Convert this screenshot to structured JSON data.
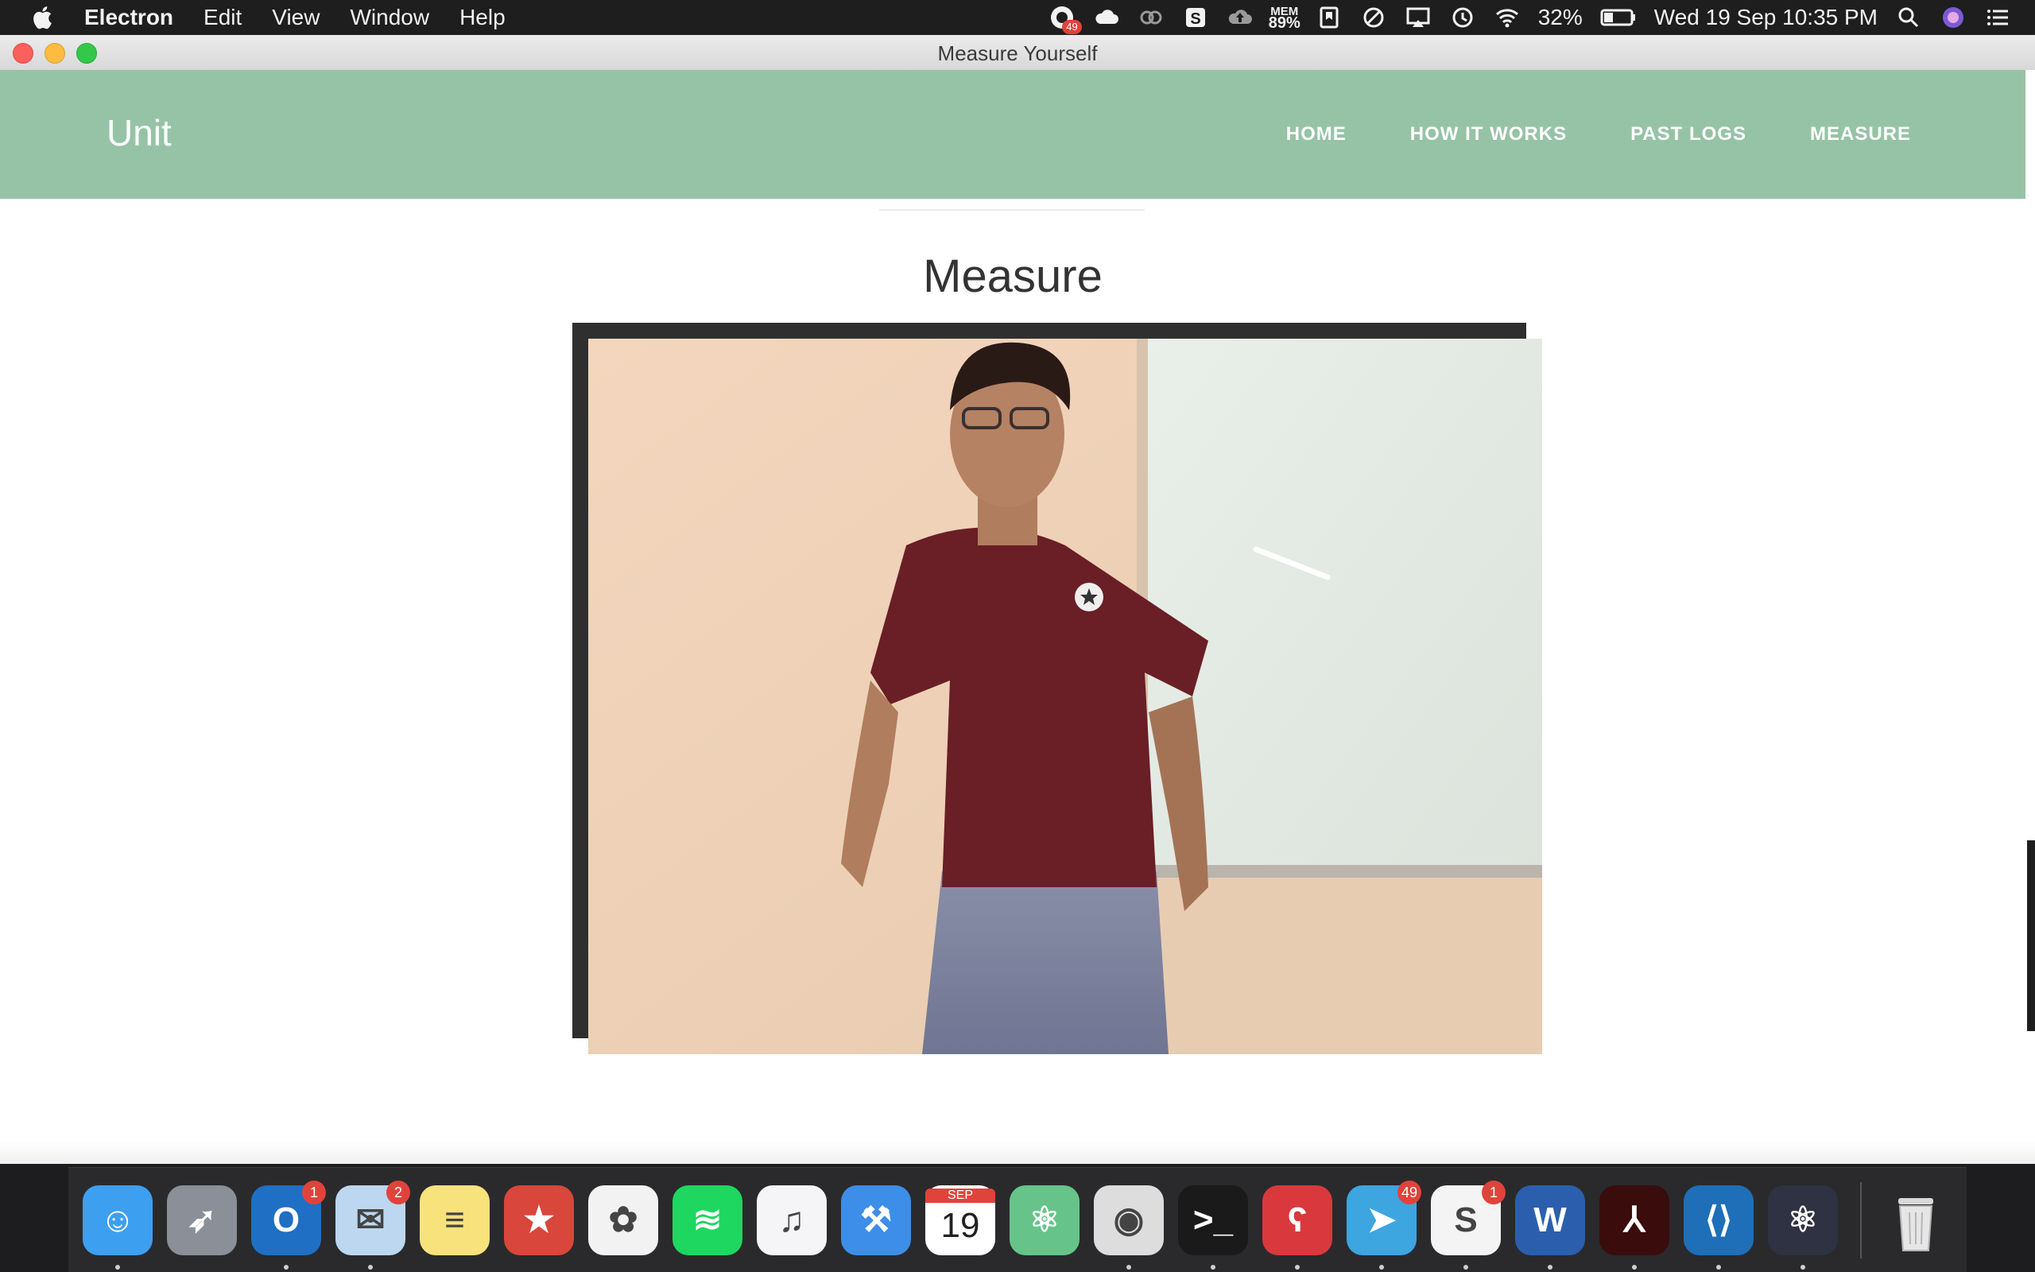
{
  "menubar": {
    "app_name": "Electron",
    "items": [
      "Edit",
      "View",
      "Window",
      "Help"
    ],
    "status": {
      "notification_badge": "49",
      "mem_label": "MEM",
      "mem_value": "89%",
      "battery": "32%",
      "datetime": "Wed 19 Sep  10:35 PM"
    }
  },
  "window": {
    "title": "Measure Yourself"
  },
  "site": {
    "brand": "Unit",
    "nav": [
      "HOME",
      "HOW IT WORKS",
      "PAST LOGS",
      "MEASURE"
    ],
    "nav_color": "#96c3a6"
  },
  "page": {
    "title": "Measure",
    "camera_feed_description": "live webcam feed"
  },
  "dock": {
    "apps": [
      {
        "name": "Finder",
        "icon": "finder-icon",
        "color": "#3d9ff0",
        "running": true
      },
      {
        "name": "Launchpad",
        "icon": "rocket-icon",
        "color": "#8a8f98",
        "running": false
      },
      {
        "name": "Outlook",
        "icon": "outlook-icon",
        "color": "#1f6fc4",
        "running": true,
        "badge": "1"
      },
      {
        "name": "Mail",
        "icon": "mail-icon",
        "color": "#bcd7ef",
        "running": true,
        "badge": "2"
      },
      {
        "name": "Notes",
        "icon": "notes-icon",
        "color": "#f7e27b",
        "running": false
      },
      {
        "name": "Wunderlist",
        "icon": "star-icon",
        "color": "#d9463b",
        "running": false
      },
      {
        "name": "Photos",
        "icon": "photos-icon",
        "color": "#f2f2f2",
        "running": false
      },
      {
        "name": "Spotify",
        "icon": "spotify-icon",
        "color": "#1ed760",
        "running": false
      },
      {
        "name": "iTunes",
        "icon": "music-icon",
        "color": "#f5f5f7",
        "running": false
      },
      {
        "name": "Xcode",
        "icon": "hammer-icon",
        "color": "#3d8ee8",
        "running": false
      },
      {
        "name": "Calendar",
        "icon": "calendar-icon",
        "color": "#ffffff",
        "running": false,
        "month": "SEP",
        "day": "19"
      },
      {
        "name": "Atom",
        "icon": "atom-icon",
        "color": "#66c48a",
        "running": false
      },
      {
        "name": "Chrome",
        "icon": "chrome-icon",
        "color": "#dddddd",
        "running": true
      },
      {
        "name": "Terminal",
        "icon": "terminal-icon",
        "color": "#1a1a1a",
        "running": true
      },
      {
        "name": "Bear",
        "icon": "bear-icon",
        "color": "#d9393c",
        "running": true
      },
      {
        "name": "Telegram",
        "icon": "telegram-icon",
        "color": "#3da5e0",
        "running": true,
        "badge": "49"
      },
      {
        "name": "Slack",
        "icon": "slack-icon",
        "color": "#f4f4f4",
        "running": true,
        "badge": "1"
      },
      {
        "name": "Word",
        "icon": "word-icon",
        "color": "#2b5fae",
        "running": true
      },
      {
        "name": "Acrobat",
        "icon": "acrobat-icon",
        "color": "#3a0c0c",
        "running": true
      },
      {
        "name": "VS Code",
        "icon": "vscode-icon",
        "color": "#1e6fb8",
        "running": true
      },
      {
        "name": "Electron",
        "icon": "electron-icon",
        "color": "#2f3242",
        "running": true
      }
    ],
    "trash": {
      "name": "Trash",
      "icon": "trash-icon"
    }
  }
}
